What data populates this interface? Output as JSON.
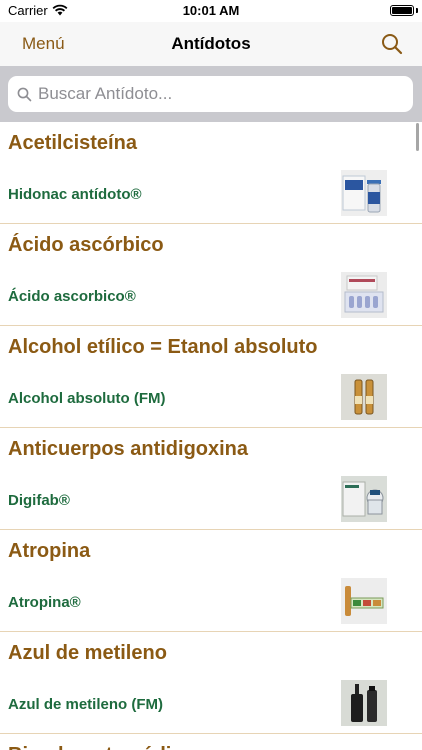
{
  "status_bar": {
    "carrier": "Carrier",
    "time": "10:01 AM",
    "wifi_icon": "wifi-icon",
    "battery_icon": "battery-icon"
  },
  "nav": {
    "back_label": "Menú",
    "title": "Antídotos",
    "search_icon": "search-icon"
  },
  "search": {
    "placeholder": "Buscar Antídoto...",
    "value": ""
  },
  "colors": {
    "accent": "#8a5a16",
    "section_title": "#8b5a14",
    "item_text": "#1e6b3e",
    "separator": "#e7d4b5",
    "search_bg": "#c9c9ce"
  },
  "sections": [
    {
      "title": "Acetilcisteína",
      "items": [
        {
          "label": "Hidonac antídoto®",
          "image": "hidonac-vial-photo"
        }
      ]
    },
    {
      "title": "Ácido ascórbico",
      "items": [
        {
          "label": "Ácido ascorbico®",
          "image": "ascorbic-acid-ampoules-photo"
        }
      ]
    },
    {
      "title": "Alcohol etílico = Etanol absoluto",
      "items": [
        {
          "label": "Alcohol absoluto (FM)",
          "image": "alcohol-ampoules-photo"
        }
      ]
    },
    {
      "title": "Anticuerpos antidigoxina",
      "items": [
        {
          "label": "Digifab®",
          "image": "digifab-box-photo"
        }
      ]
    },
    {
      "title": "Atropina",
      "items": [
        {
          "label": "Atropina®",
          "image": "atropina-ampoules-photo"
        }
      ]
    },
    {
      "title": "Azul de metileno",
      "items": [
        {
          "label": "Azul de metileno (FM)",
          "image": "methylene-blue-bottle-photo"
        }
      ]
    },
    {
      "title": "Bicarbonato sódico",
      "items": []
    }
  ]
}
